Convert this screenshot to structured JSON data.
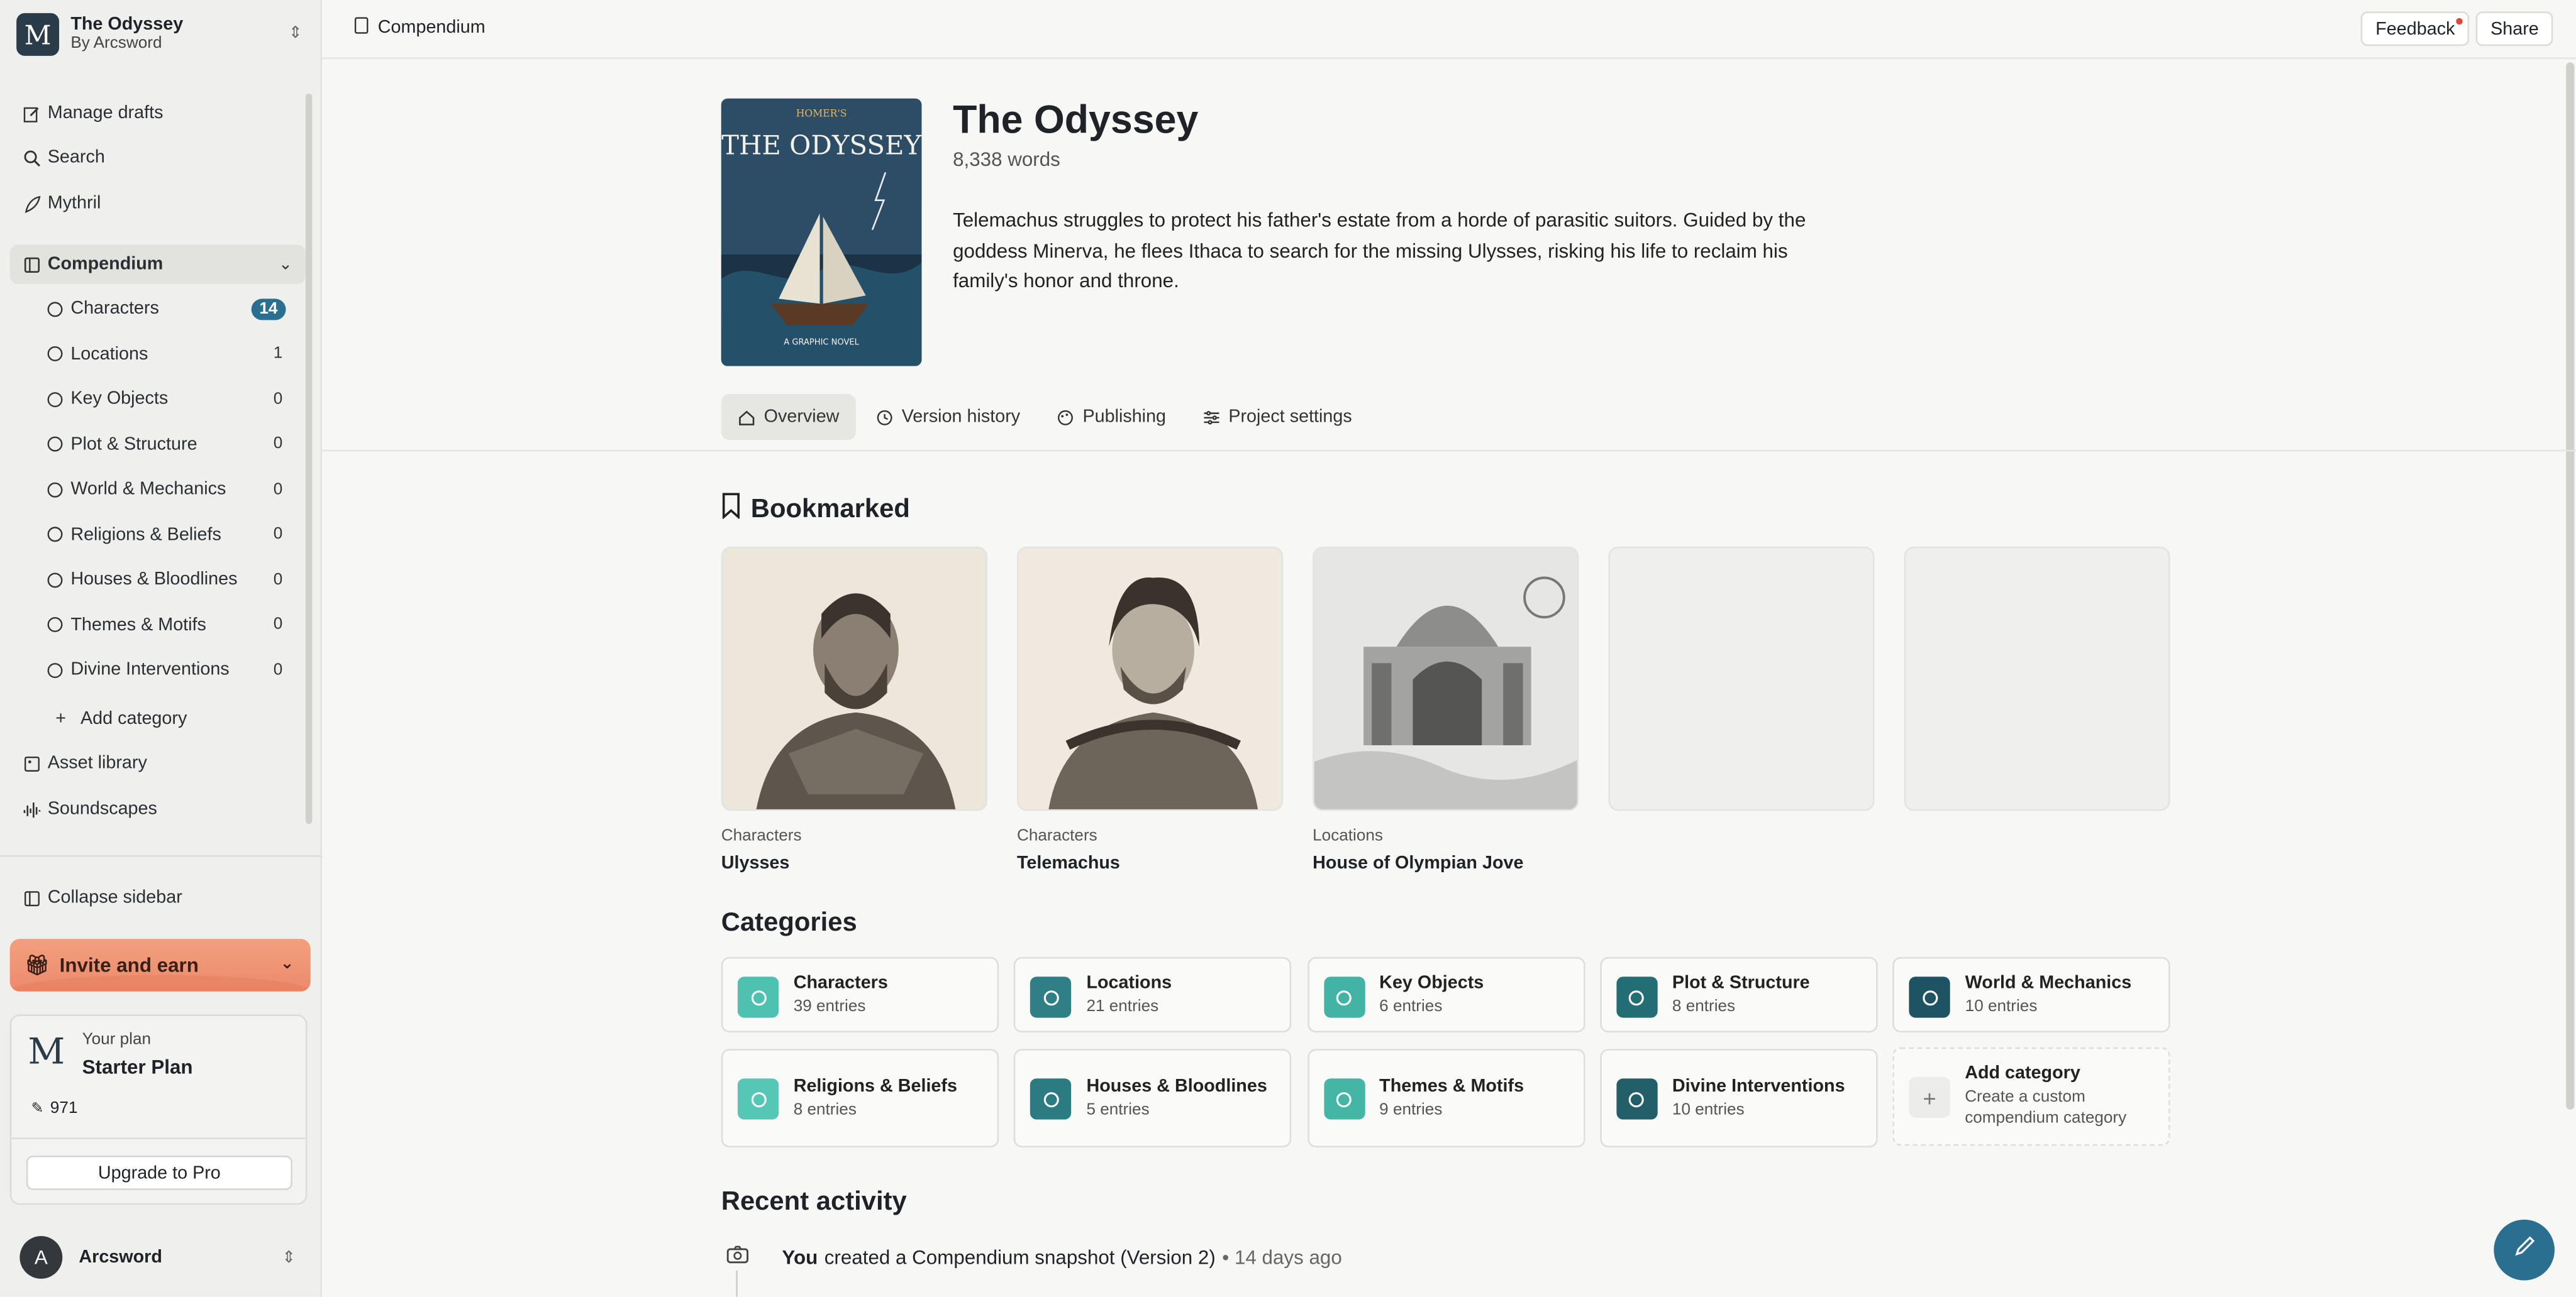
{
  "project": {
    "title": "The Odyssey",
    "byline": "By Arcsword",
    "logo_letter": "M"
  },
  "nav": {
    "manage_drafts": "Manage drafts",
    "search": "Search",
    "mythril": "Mythril",
    "compendium": "Compendium",
    "asset_library": "Asset library",
    "soundscapes": "Soundscapes",
    "add_category": "Add category",
    "collapse": "Collapse sidebar",
    "categories": [
      {
        "label": "Characters",
        "count": "14"
      },
      {
        "label": "Locations",
        "count": "1"
      },
      {
        "label": "Key Objects",
        "count": "0"
      },
      {
        "label": "Plot & Structure",
        "count": "0"
      },
      {
        "label": "World & Mechanics",
        "count": "0"
      },
      {
        "label": "Religions & Beliefs",
        "count": "0"
      },
      {
        "label": "Houses & Bloodlines",
        "count": "0"
      },
      {
        "label": "Themes & Motifs",
        "count": "0"
      },
      {
        "label": "Divine Interventions",
        "count": "0"
      }
    ]
  },
  "invite": {
    "label": "Invite and earn"
  },
  "plan": {
    "label": "Your plan",
    "name": "Starter Plan",
    "credits": "971",
    "upgrade": "Upgrade to Pro"
  },
  "user": {
    "name": "Arcsword",
    "initial": "A"
  },
  "topbar": {
    "breadcrumb": "Compendium",
    "feedback": "Feedback",
    "share": "Share"
  },
  "cover": {
    "top": "HOMER'S",
    "title": "THE ODYSSEY",
    "subtitle": "A GRAPHIC NOVEL"
  },
  "book": {
    "title": "The Odyssey",
    "words": "8,338 words",
    "description": "Telemachus struggles to protect his father's estate from a horde of parasitic suitors. Guided by the goddess Minerva, he flees Ithaca to search for the missing Ulysses, risking his life to reclaim his family's honor and throne."
  },
  "tabs": [
    "Overview",
    "Version history",
    "Publishing",
    "Project settings"
  ],
  "bookmarked": {
    "title": "Bookmarked",
    "items": [
      {
        "category": "Characters",
        "name": "Ulysses"
      },
      {
        "category": "Characters",
        "name": "Telemachus"
      },
      {
        "category": "Locations",
        "name": "House of Olympian Jove"
      }
    ]
  },
  "categories": {
    "title": "Categories",
    "items": [
      {
        "name": "Characters",
        "entries": "39 entries",
        "color": "#4fc1b0"
      },
      {
        "name": "Locations",
        "entries": "21 entries",
        "color": "#2e7f86"
      },
      {
        "name": "Key Objects",
        "entries": "6 entries",
        "color": "#42b3a4"
      },
      {
        "name": "Plot & Structure",
        "entries": "8 entries",
        "color": "#236e74"
      },
      {
        "name": "World & Mechanics",
        "entries": "10 entries",
        "color": "#1d5362"
      },
      {
        "name": "Religions & Beliefs",
        "entries": "8 entries",
        "color": "#56c6b5"
      },
      {
        "name": "Houses & Bloodlines",
        "entries": "5 entries",
        "color": "#2a7b82"
      },
      {
        "name": "Themes & Motifs",
        "entries": "9 entries",
        "color": "#45b6a6"
      },
      {
        "name": "Divine Interventions",
        "entries": "10 entries",
        "color": "#225f68"
      }
    ],
    "add": {
      "name": "Add category",
      "desc": "Create a custom compendium category"
    }
  },
  "activity": {
    "title": "Recent activity",
    "items": [
      {
        "actor": "You",
        "text": "created a Compendium snapshot (Version 2)",
        "time": "• 14 days ago"
      }
    ]
  }
}
